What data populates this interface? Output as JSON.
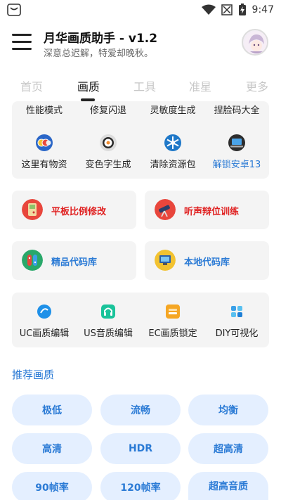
{
  "status_bar": {
    "time": "9:47",
    "icons": [
      "app-notification-icon",
      "wifi-icon",
      "no-signal-icon",
      "battery-charging-icon"
    ]
  },
  "header": {
    "title": "月华画质助手 - v1.2",
    "subtitle": "深意总迟解，特爱却晚秋。"
  },
  "tabs": [
    {
      "label": "首页",
      "active": false
    },
    {
      "label": "画质",
      "active": true
    },
    {
      "label": "工具",
      "active": false
    },
    {
      "label": "准星",
      "active": false
    },
    {
      "label": "更多",
      "active": false
    }
  ],
  "top_grid": {
    "row1": [
      "性能模式",
      "修复闪退",
      "灵敏度生成",
      "捏脸码大全"
    ],
    "row2": [
      {
        "label": "这里有物资",
        "icon": "coins-icon"
      },
      {
        "label": "变色字生成",
        "icon": "sushi-icon"
      },
      {
        "label": "清除资源包",
        "icon": "snowflake-icon"
      },
      {
        "label": "解锁安卓13",
        "icon": "laptop-icon"
      }
    ]
  },
  "feature_cards": [
    {
      "label": "平板比例修改",
      "icon": "gameboy-icon"
    },
    {
      "label": "听声辩位训练",
      "icon": "telescope-icon"
    },
    {
      "label": "精品代码库",
      "icon": "switch-console-icon"
    },
    {
      "label": "本地代码库",
      "icon": "computer-icon"
    }
  ],
  "editor_grid": [
    {
      "label": "UC画质编辑",
      "icon": "uc-icon"
    },
    {
      "label": "US音质编辑",
      "icon": "headset-icon"
    },
    {
      "label": "EC画质锁定",
      "icon": "layers-icon"
    },
    {
      "label": "DIY可视化",
      "icon": "diy-icon"
    }
  ],
  "section": {
    "title": "推荐画质"
  },
  "quality_pills": [
    "极低",
    "流畅",
    "均衡",
    "高清",
    "HDR",
    "超高清",
    "90帧率",
    "120帧率",
    "超高音质"
  ],
  "colors": {
    "accent": "#2a7ad5",
    "red": "#e02020",
    "card_bg": "#f4f4f4",
    "pill_bg": "#e4efff"
  }
}
